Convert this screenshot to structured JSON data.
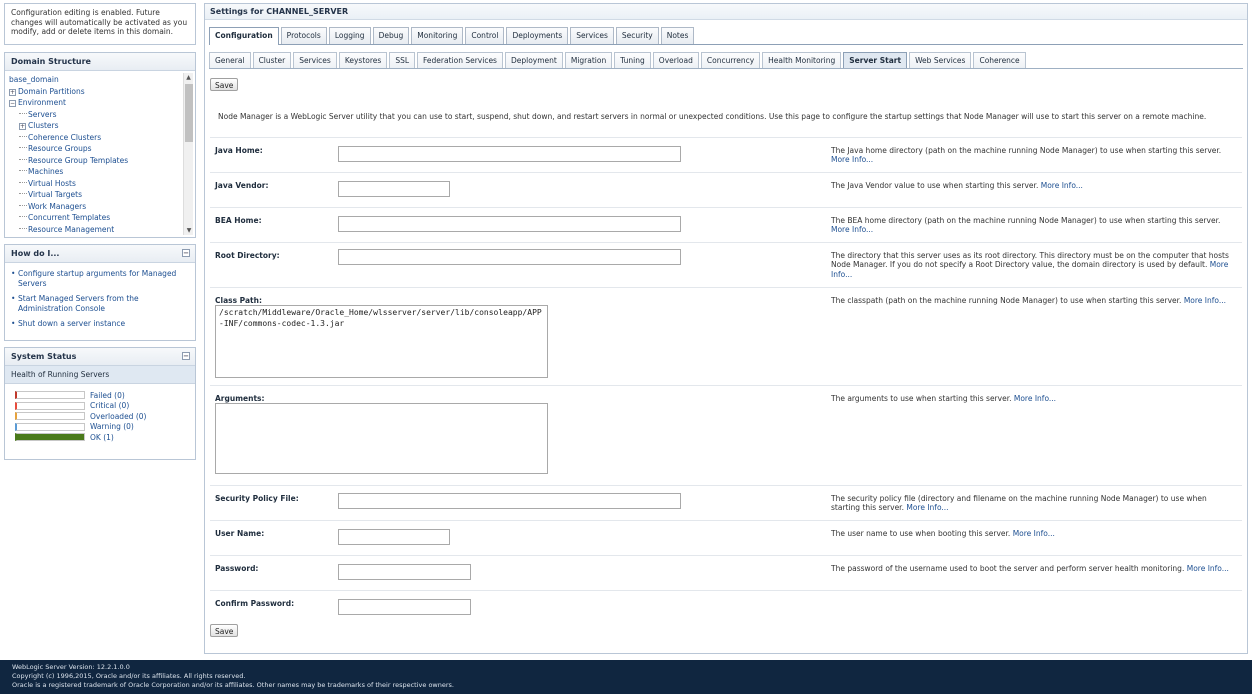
{
  "change_center": {
    "message": "Configuration editing is enabled. Future changes will automatically be activated as you modify, add or delete items in this domain."
  },
  "domain_structure": {
    "title": "Domain Structure",
    "nodes": [
      {
        "label": "base_domain",
        "depth": 0,
        "toggle": ""
      },
      {
        "label": "Domain Partitions",
        "depth": 0,
        "toggle": "+"
      },
      {
        "label": "Environment",
        "depth": 0,
        "toggle": "-"
      },
      {
        "label": "Servers",
        "depth": 1,
        "toggle": ""
      },
      {
        "label": "Clusters",
        "depth": 1,
        "toggle": "+"
      },
      {
        "label": "Coherence Clusters",
        "depth": 1,
        "toggle": ""
      },
      {
        "label": "Resource Groups",
        "depth": 1,
        "toggle": ""
      },
      {
        "label": "Resource Group Templates",
        "depth": 1,
        "toggle": ""
      },
      {
        "label": "Machines",
        "depth": 1,
        "toggle": ""
      },
      {
        "label": "Virtual Hosts",
        "depth": 1,
        "toggle": ""
      },
      {
        "label": "Virtual Targets",
        "depth": 1,
        "toggle": ""
      },
      {
        "label": "Work Managers",
        "depth": 1,
        "toggle": ""
      },
      {
        "label": "Concurrent Templates",
        "depth": 1,
        "toggle": ""
      },
      {
        "label": "Resource Management",
        "depth": 1,
        "toggle": ""
      }
    ]
  },
  "how_do_i": {
    "title": "How do I...",
    "items": [
      "Configure startup arguments for Managed Servers",
      "Start Managed Servers from the Administration Console",
      "Shut down a server instance"
    ]
  },
  "system_status": {
    "title": "System Status",
    "subtitle": "Health of Running Servers",
    "rows": [
      {
        "label": "Failed (0)",
        "color": "#c0392b",
        "fill": 0
      },
      {
        "label": "Critical (0)",
        "color": "#e74c3c",
        "fill": 0
      },
      {
        "label": "Overloaded (0)",
        "color": "#e6a23c",
        "fill": 0
      },
      {
        "label": "Warning (0)",
        "color": "#5b9bd5",
        "fill": 0
      },
      {
        "label": "OK (1)",
        "color": "#4a7a1a",
        "fill": 1
      }
    ]
  },
  "main": {
    "title": "Settings for CHANNEL_SERVER",
    "tabs": [
      "Configuration",
      "Protocols",
      "Logging",
      "Debug",
      "Monitoring",
      "Control",
      "Deployments",
      "Services",
      "Security",
      "Notes"
    ],
    "active_tab": "Configuration",
    "subtabs": [
      "General",
      "Cluster",
      "Services",
      "Keystores",
      "SSL",
      "Federation Services",
      "Deployment",
      "Migration",
      "Tuning",
      "Overload",
      "Concurrency",
      "Health Monitoring",
      "Server Start",
      "Web Services",
      "Coherence"
    ],
    "active_subtab": "Server Start",
    "save_label": "Save",
    "intro": "Node Manager is a WebLogic Server utility that you can use to start, suspend, shut down, and restart servers in normal or unexpected conditions. Use this page to configure the startup settings that Node Manager will use to start this server on a remote machine.",
    "more_info": "More Info...",
    "fields": {
      "java_home": {
        "label": "Java Home:",
        "value": "",
        "help": "The Java home directory (path on the machine running Node Manager) to use when starting this server."
      },
      "java_vendor": {
        "label": "Java Vendor:",
        "value": "",
        "help": "The Java Vendor value to use when starting this server."
      },
      "bea_home": {
        "label": "BEA Home:",
        "value": "",
        "help": "The BEA home directory (path on the machine running Node Manager) to use when starting this server."
      },
      "root_directory": {
        "label": "Root Directory:",
        "value": "",
        "help": "The directory that this server uses as its root directory. This directory must be on the computer that hosts Node Manager. If you do not specify a Root Directory value, the domain directory is used by default."
      },
      "class_path": {
        "label": "Class Path:",
        "value": "/scratch/Middleware/Oracle_Home/wlsserver/server/lib/consoleapp/APP-INF/commons-codec-1.3.jar",
        "help": "The classpath (path on the machine running Node Manager) to use when starting this server."
      },
      "arguments": {
        "label": "Arguments:",
        "value": "",
        "help": "The arguments to use when starting this server."
      },
      "security_policy_file": {
        "label": "Security Policy File:",
        "value": "",
        "help": "The security policy file (directory and filename on the machine running Node Manager) to use when starting this server."
      },
      "user_name": {
        "label": "User Name:",
        "value": "",
        "help": "The user name to use when booting this server."
      },
      "password": {
        "label": "Password:",
        "value": "",
        "help": "The password of the username used to boot the server and perform server health monitoring."
      },
      "confirm_password": {
        "label": "Confirm Password:",
        "value": ""
      }
    }
  },
  "footer": {
    "version": "WebLogic Server Version: 12.2.1.0.0",
    "copyright": "Copyright (c) 1996,2015, Oracle and/or its affiliates. All rights reserved.",
    "trademark": "Oracle is a registered trademark of Oracle Corporation and/or its affiliates. Other names may be trademarks of their respective owners."
  }
}
